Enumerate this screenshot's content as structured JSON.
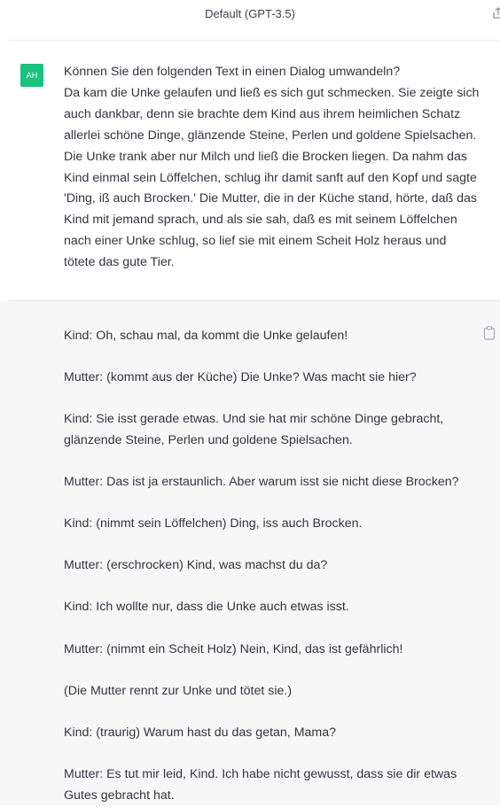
{
  "header": {
    "model_title": "Default (GPT-3.5)"
  },
  "user_message": {
    "avatar_initials": "AH",
    "request_line": "Können Sie den folgenden Text in einen Dialog umwandeln?",
    "source_text": "Da kam die Unke gelaufen und ließ es sich gut schmecken. Sie zeigte sich auch dankbar, denn sie brachte dem Kind aus ihrem heimlichen Schatz allerlei schöne Dinge, glänzende Steine, Perlen und goldene Spielsachen. Die Unke trank aber nur Milch und ließ die Brocken liegen. Da nahm das Kind einmal sein Löffelchen, schlug ihr damit sanft auf den Kopf und sagte 'Ding, iß auch Brocken.' Die Mutter, die in der Küche stand, hörte, daß das Kind mit jemand sprach, und als sie sah, daß es mit seinem Löffelchen nach einer Unke schlug, so lief sie mit einem Scheit Holz heraus und tötete das gute Tier."
  },
  "assistant_message": {
    "lines": [
      "Kind: Oh, schau mal, da kommt die Unke gelaufen!",
      "Mutter: (kommt aus der Küche) Die Unke? Was macht sie hier?",
      "Kind: Sie isst gerade etwas. Und sie hat mir schöne Dinge gebracht, glänzende Steine, Perlen und goldene Spielsachen.",
      "Mutter: Das ist ja erstaunlich. Aber warum isst sie nicht diese Brocken?",
      "Kind: (nimmt sein Löffelchen) Ding, iss auch Brocken.",
      "Mutter: (erschrocken) Kind, was machst du da?",
      "Kind: Ich wollte nur, dass die Unke auch etwas isst.",
      "Mutter: (nimmt ein Scheit Holz) Nein, Kind, das ist gefährlich!",
      "(Die Mutter rennt zur Unke und tötet sie.)",
      "Kind: (traurig) Warum hast du das getan, Mama?",
      "Mutter: Es tut mir leid, Kind. Ich habe nicht gewusst, dass sie dir etwas Gutes gebracht hat."
    ]
  },
  "icons": {
    "share": "share-icon",
    "copy": "clipboard-icon"
  },
  "colors": {
    "avatar_bg": "#19c37d",
    "assistant_bg": "#f7f7f8",
    "text": "#343541"
  }
}
